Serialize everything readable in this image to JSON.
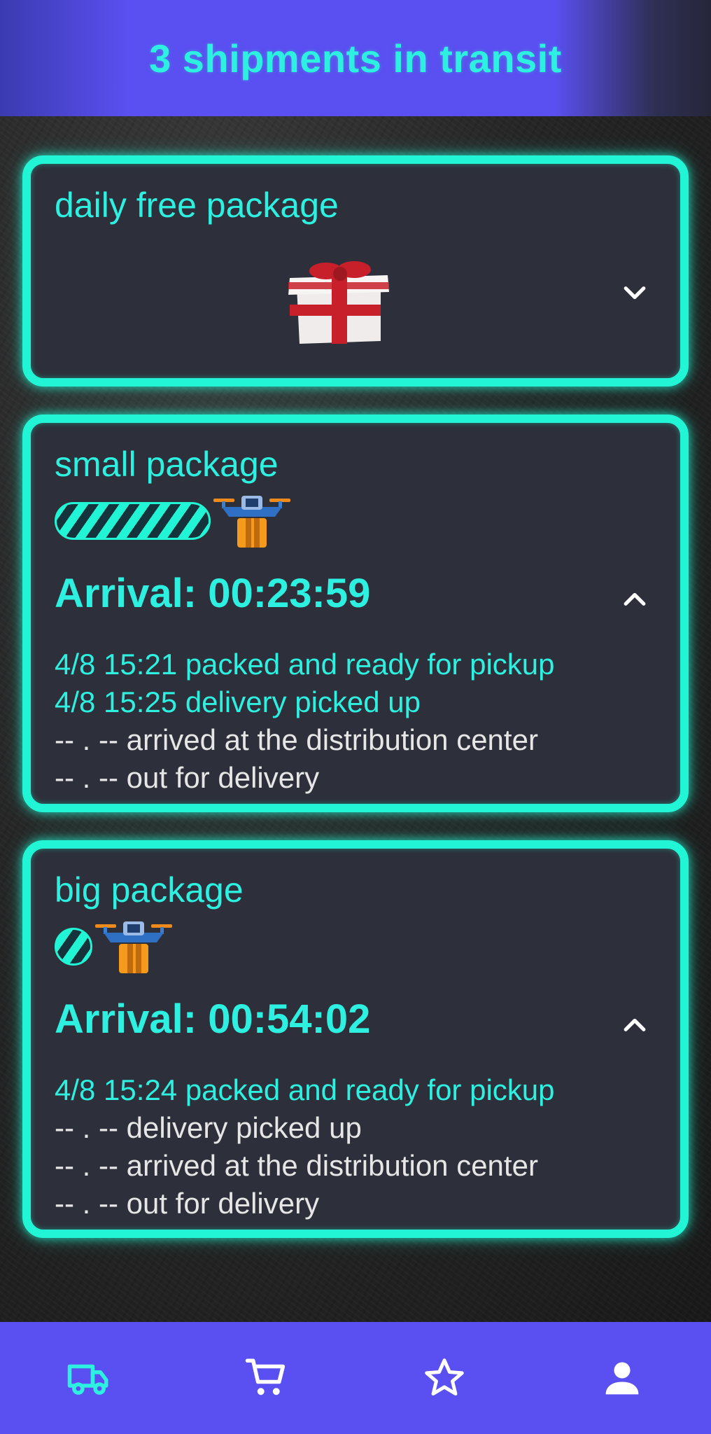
{
  "header": {
    "title": "3 shipments in transit"
  },
  "colors": {
    "accent": "#22f5d5",
    "nav_bg": "#5a4ff0",
    "card_bg": "#2d303a",
    "pending_text": "#e6e6e6"
  },
  "cards": [
    {
      "title": "daily free package",
      "icon": "gift-box-icon",
      "expanded": false,
      "toggle_icon": "chevron-down-icon"
    },
    {
      "title": "small package",
      "progress": 0.55,
      "arrival": "Arrival: 00:23:59",
      "expanded": true,
      "toggle_icon": "chevron-up-icon",
      "events": [
        {
          "text": "4/8 15:21 packed and ready for pickup",
          "done": true
        },
        {
          "text": "4/8 15:25 delivery picked up",
          "done": true
        },
        {
          "text": "-- . -- arrived at the distribution center",
          "done": false
        },
        {
          "text": "-- . -- out for delivery",
          "done": false
        }
      ]
    },
    {
      "title": "big package",
      "progress": 0.1,
      "arrival": "Arrival: 00:54:02",
      "expanded": true,
      "toggle_icon": "chevron-up-icon",
      "events": [
        {
          "text": "4/8 15:24 packed and ready for pickup",
          "done": true
        },
        {
          "text": "-- . -- delivery picked up",
          "done": false
        },
        {
          "text": "-- . -- arrived at the distribution center",
          "done": false
        },
        {
          "text": "-- . -- out for delivery",
          "done": false
        }
      ]
    }
  ],
  "nav": [
    {
      "icon": "truck-icon",
      "active": true
    },
    {
      "icon": "cart-icon",
      "active": false
    },
    {
      "icon": "star-icon",
      "active": false
    },
    {
      "icon": "person-icon",
      "active": false
    }
  ]
}
